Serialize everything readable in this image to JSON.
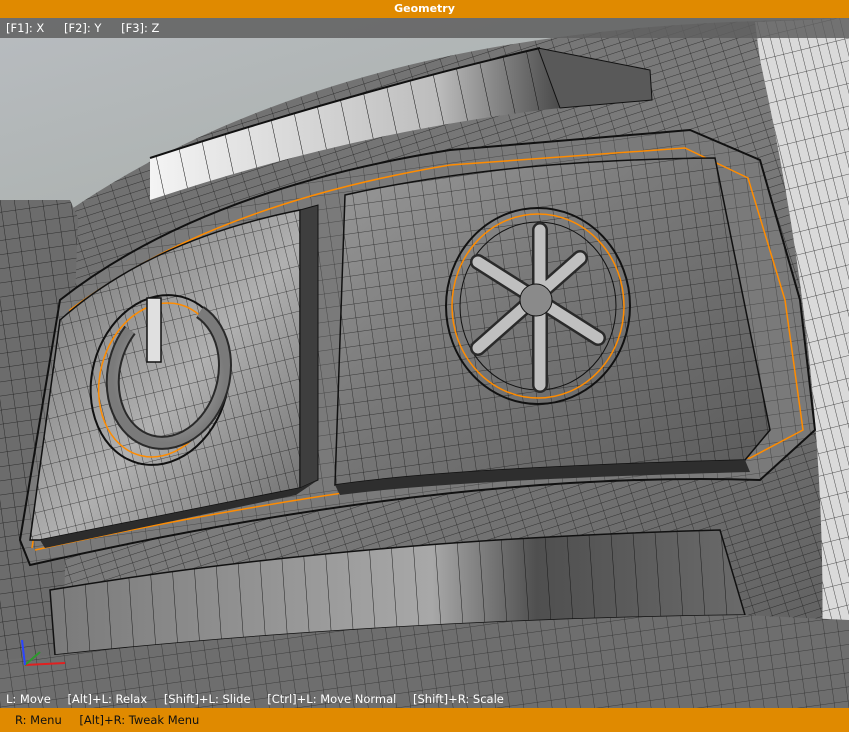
{
  "window": {
    "title": "Geometry"
  },
  "axis_hints": [
    {
      "key": "[F1]: X"
    },
    {
      "key": "[F2]: Y"
    },
    {
      "key": "[F3]: Z"
    }
  ],
  "shortcut_hints": [
    "L: Move",
    "[Alt]+L: Relax",
    "[Shift]+L: Slide",
    "[Ctrl]+L: Move Normal",
    "[Shift]+R: Scale"
  ],
  "footer_hints": [
    "R: Menu",
    "[Alt]+R: Tweak Menu"
  ],
  "colors": {
    "accent": "#e08a00",
    "selection_edge": "#ff8c00",
    "wire": "#101010",
    "surface": "#6f6f6f"
  },
  "icons": {
    "gizmo": "xyz-axis-gizmo-icon",
    "power": "power-symbol-icon",
    "bluetooth": "bluetooth-symbol-icon"
  }
}
